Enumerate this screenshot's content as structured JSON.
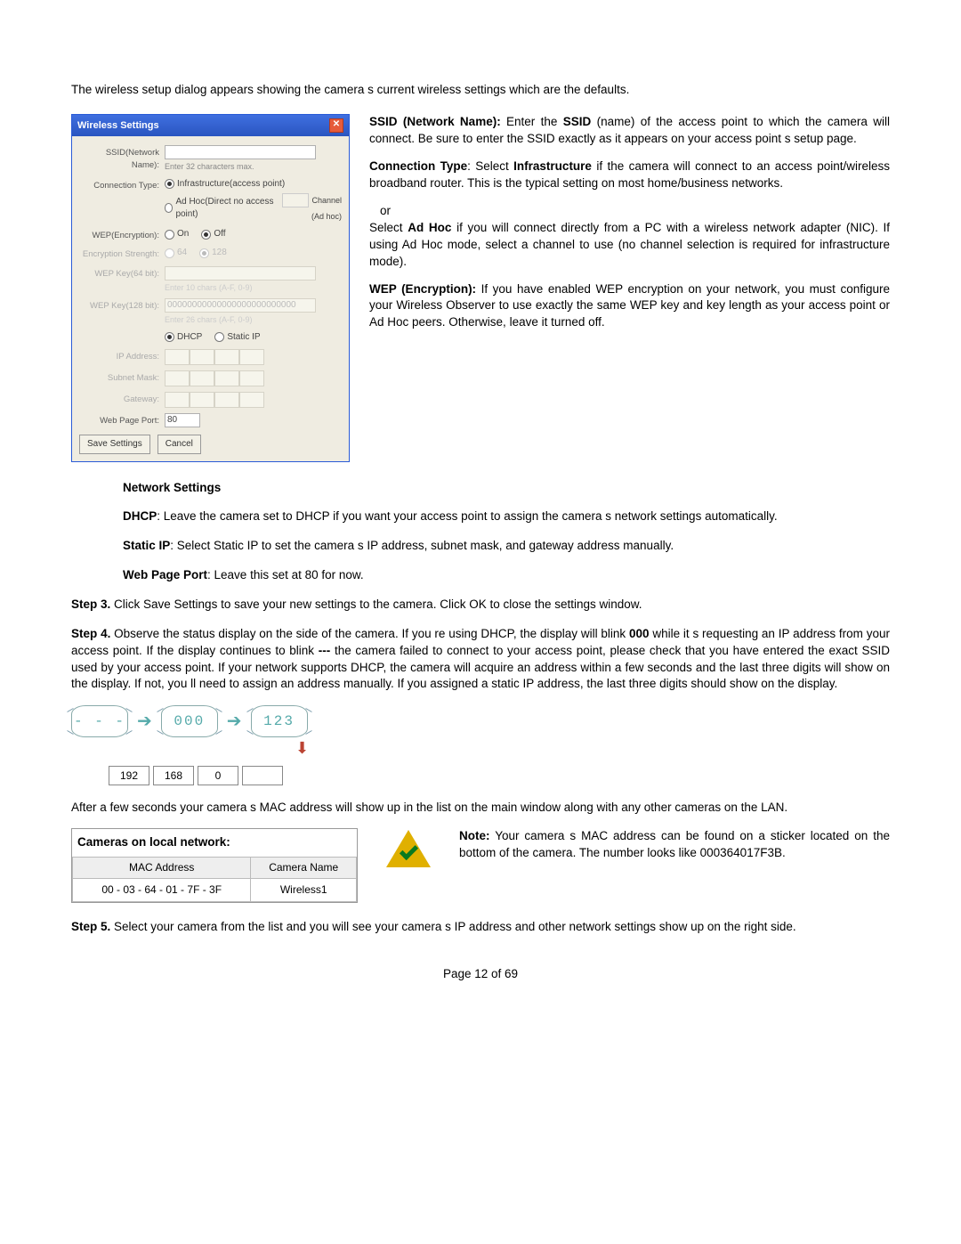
{
  "intro": "The wireless setup dialog appears showing the camera s current wireless settings which are the defaults.",
  "dialog": {
    "title": "Wireless Settings",
    "close_glyph": "✕",
    "ssid_label": "SSID(Network Name):",
    "ssid_hint": "Enter 32 characters max.",
    "conn_label": "Connection Type:",
    "conn_infra": "Infrastructure(access point)",
    "conn_adhoc": "Ad Hoc(Direct no access point)",
    "channel_label": "Channel",
    "channel_sub": "(Ad hoc)",
    "wep_label": "WEP(Encryption):",
    "wep_on": "On",
    "wep_off": "Off",
    "enc_label": "Encryption Strength:",
    "enc_64": "64",
    "enc_128": "128",
    "key64_label": "WEP Key(64 bit):",
    "key64_hint": "Enter 10 chars (A-F, 0-9)",
    "key128_label": "WEP Key(128 bit):",
    "key128_value": "00000000000000000000000000",
    "key128_hint": "Enter 26 chars (A-F, 0-9)",
    "dhcp": "DHCP",
    "staticip": "Static IP",
    "ip_label": "IP Address:",
    "subnet_label": "Subnet Mask:",
    "gateway_label": "Gateway:",
    "port_label": "Web Page Port:",
    "port_value": "80",
    "save_btn": "Save Settings",
    "cancel_btn": "Cancel"
  },
  "right": {
    "ssid_b": "SSID (Network Name):",
    "ssid_t1": " Enter the ",
    "ssid_b2": "SSID",
    "ssid_t2": " (name) of the access point to which the camera will connect. Be sure to enter the SSID exactly as it appears on your access point s setup page.",
    "conn_b": "Connection Type",
    "conn_t1": ": Select ",
    "conn_b2": "Infrastructure",
    "conn_t2": " if the camera will connect to an access point/wireless broadband router. This is the typical setting on most home/business networks.",
    "or": "or",
    "adhoc_b": "Ad Hoc",
    "adhoc_t1": "Select ",
    "adhoc_t2": " if you will connect directly from a PC with a wireless network adapter (NIC). If using Ad Hoc mode, select a channel to use (no channel selection is required for infrastructure mode).",
    "wep_b": "WEP (Encryption):",
    "wep_t": " If you have enabled WEP encryption on your network, you must configure your Wireless Observer to use exactly the same WEP key and key length as your access point or Ad Hoc peers. Otherwise, leave it turned off."
  },
  "net": {
    "heading": "Network Settings",
    "dhcp_b": "DHCP",
    "dhcp_t": ": Leave the camera set to DHCP if you want your access point to assign the camera s network settings automatically.",
    "static_b": "Static IP",
    "static_t": ": Select Static IP to set the camera s IP address, subnet mask, and gateway address manually.",
    "port_b": "Web Page Port",
    "port_t": ": Leave this set at 80 for now."
  },
  "step3": {
    "b": "Step 3.",
    "t": " Click  Save Settings  to save your new settings to the camera.  Click  OK  to close the settings window."
  },
  "step4": {
    "b": "Step 4.",
    "t1": " Observe the status display on the side of the camera. If you re using DHCP, the display will blink ",
    "n000": "000",
    "t2": " while it s requesting an IP address from your access point. If the display continues to blink ",
    "ndash": "---",
    "t3": " the camera failed to connect to your access point, please check that you have entered the exact SSID used by your access point. If your network supports DHCP, the camera will acquire an address within a few seconds and the last three digits will show on the display. If not, you ll need to assign an address manually. If you assigned a static IP address, the last three digits should show on the display."
  },
  "display": {
    "dashes": "- - -",
    "zeros": "000",
    "n123": "123",
    "ip": [
      "192",
      "168",
      "0",
      ""
    ]
  },
  "after_mac": "After a few seconds your camera s MAC address will show up in the list on the main window along with any other cameras on the LAN.",
  "cameras": {
    "title": "Cameras on local network:",
    "col_mac": "MAC Address",
    "col_name": "Camera Name",
    "row_mac": "00 - 03 - 64 - 01 - 7F - 3F",
    "row_name": "Wireless1"
  },
  "note": {
    "b": "Note:",
    "t": " Your camera s MAC address can be found on a sticker located on the bottom of the camera. The number looks like 000364017F3B."
  },
  "step5": {
    "b": "Step 5.",
    "t": " Select your camera from the list and you will see your camera s IP address and other network settings show up on the right side."
  },
  "footer": "Page 12 of 69"
}
